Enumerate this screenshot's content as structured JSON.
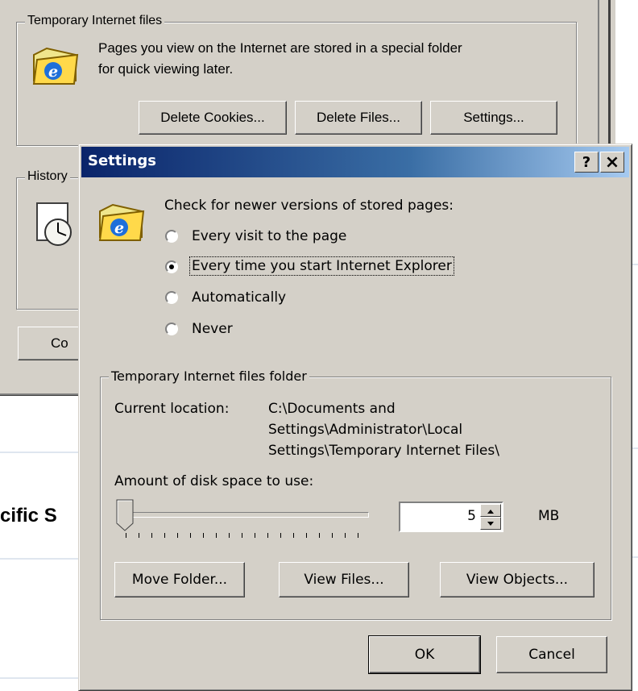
{
  "background": {
    "temp_group_title": "Temporary Internet files",
    "temp_desc_line1": "Pages you view on the Internet are stored in a special folder",
    "temp_desc_line2": "for quick viewing later.",
    "delete_cookies": "Delete Cookies...",
    "delete_files": "Delete Files...",
    "settings": "Settings...",
    "history_title": "History",
    "colors_button_partial": "Co",
    "page_text_partial": "cific S"
  },
  "dialog": {
    "title": "Settings",
    "help_button": "?",
    "close_button": "×",
    "check_label": "Check for newer versions of stored pages:",
    "options": [
      {
        "label": "Every visit to the page",
        "selected": false
      },
      {
        "label": "Every time you start Internet Explorer",
        "selected": true
      },
      {
        "label": "Automatically",
        "selected": false
      },
      {
        "label": "Never",
        "selected": false
      }
    ],
    "folder_group_title": "Temporary Internet files folder",
    "current_location_label": "Current location:",
    "location_line1": "C:\\Documents and",
    "location_line2": "Settings\\Administrator\\Local",
    "location_line3": "Settings\\Temporary Internet Files\\",
    "disk_space_label": "Amount of disk space to use:",
    "disk_space_value": "5",
    "disk_space_unit": "MB",
    "slider_position": 0,
    "move_folder": "Move Folder...",
    "view_files": "View Files...",
    "view_objects": "View Objects...",
    "ok": "OK",
    "cancel": "Cancel"
  },
  "colors": {
    "dialog_bg": "#d4d0c8",
    "titlebar_start": "#0a246a",
    "titlebar_end": "#a6caf0"
  },
  "icons": [
    "ie-folder-icon",
    "history-clock-icon",
    "spinner-up-icon",
    "spinner-down-icon"
  ]
}
